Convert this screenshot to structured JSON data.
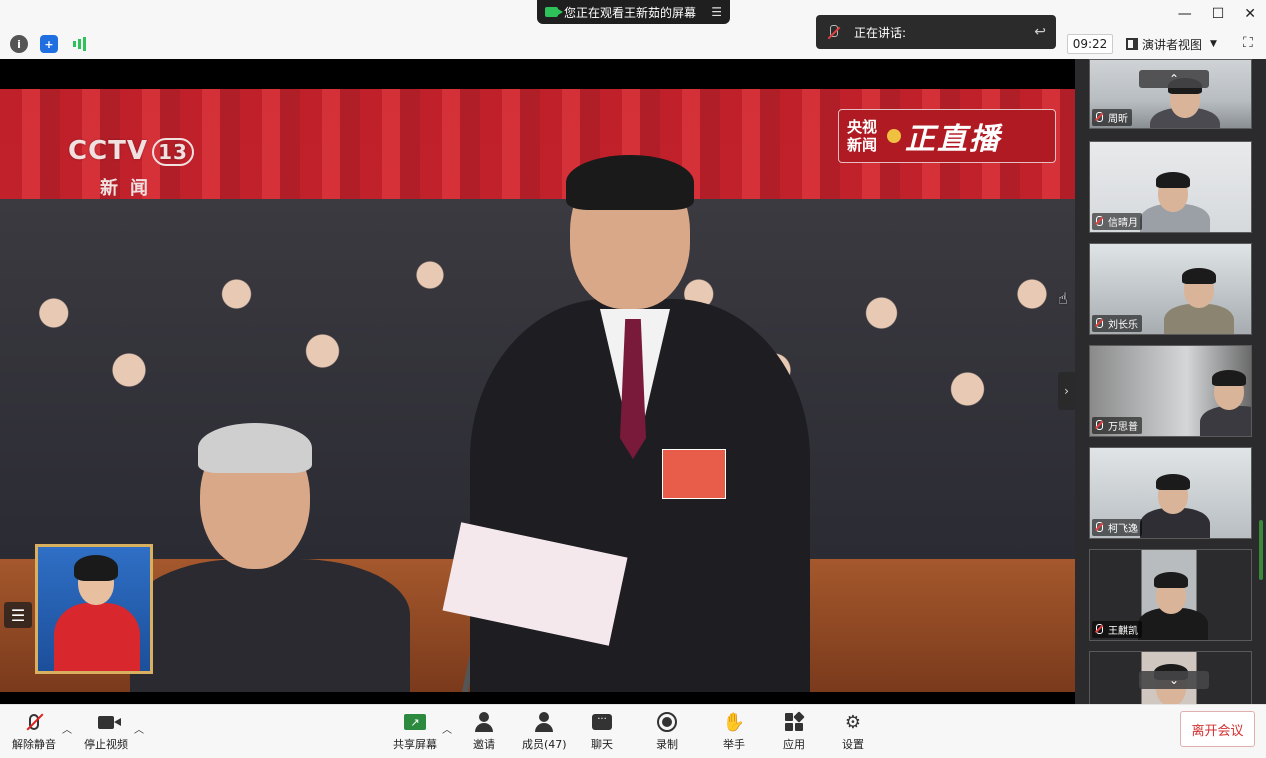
{
  "top": {
    "share_banner": "您正在观看王新茹的屏幕",
    "share_menu": "☰",
    "speaking_label": "正在讲话:",
    "time": "09:22",
    "view_mode": "演讲者视图",
    "win_min": "—",
    "win_max": "☐",
    "win_close": "✕"
  },
  "video": {
    "channel_logo": "CCTV",
    "channel_num": "13",
    "channel_sub": "新闻",
    "live_logo_left": "央视新闻",
    "live_logo_right": "正直播"
  },
  "gallery": {
    "participants": [
      {
        "name": "周昕"
      },
      {
        "name": "信晴月"
      },
      {
        "name": "刘长乐"
      },
      {
        "name": "万思普"
      },
      {
        "name": "柯飞逸"
      },
      {
        "name": "王麒凯"
      }
    ]
  },
  "toolbar": {
    "unmute": "解除静音",
    "stop_video": "停止视频",
    "share_screen": "共享屏幕",
    "invite": "邀请",
    "members": "成员(47)",
    "chat": "聊天",
    "record": "录制",
    "raise_hand": "举手",
    "apps": "应用",
    "settings": "设置",
    "leave": "离开会议"
  },
  "colors": {
    "share_green": "#2b8a3e",
    "leave_red": "#d32f2f",
    "mute_red": "#e02020"
  }
}
